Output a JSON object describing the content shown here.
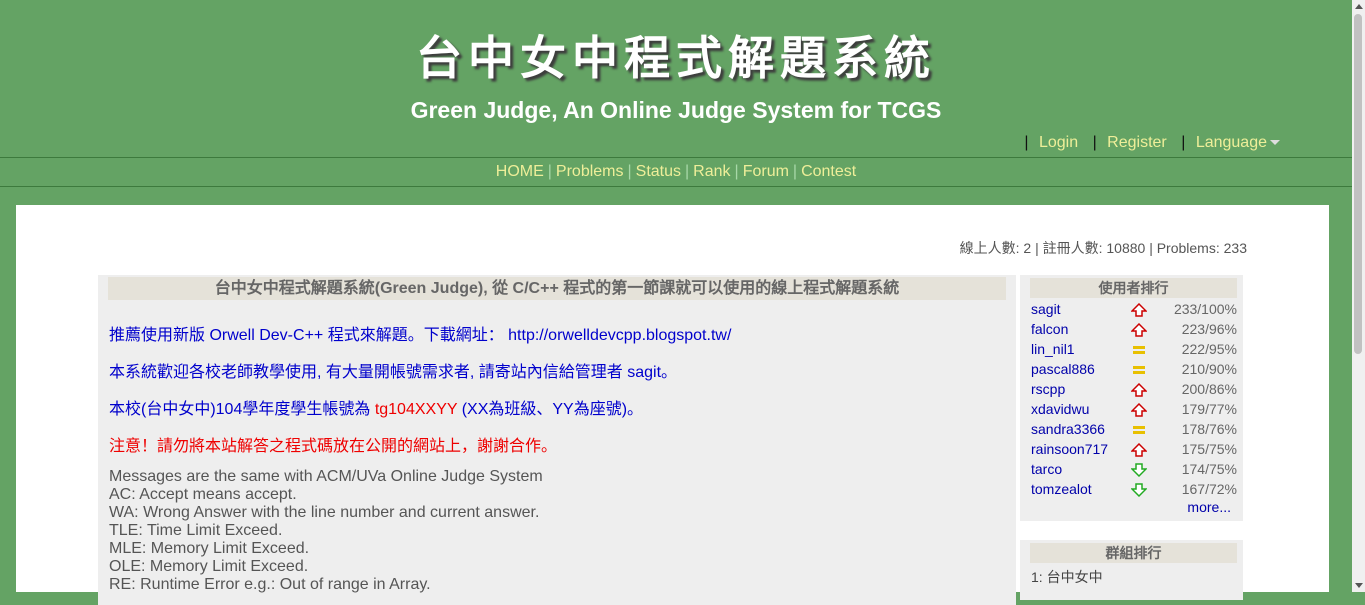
{
  "header": {
    "logo_text": "台中女中程式解題系統",
    "subtitle": "Green Judge, An Online Judge System for TCGS",
    "login": "Login",
    "register": "Register",
    "language": "Language"
  },
  "nav": {
    "home": "HOME",
    "problems": "Problems",
    "status": "Status",
    "rank": "Rank",
    "forum": "Forum",
    "contest": "Contest"
  },
  "stats": "線上人數: 2 | 註冊人數: 10880 | Problems: 233",
  "main": {
    "title": "台中女中程式解題系統(Green Judge), 從 C/C++ 程式的第一節課就可以使用的線上程式解題系統",
    "msg1_text": "推薦使用新版 Orwell Dev-C++ 程式來解題。下載網址：",
    "msg1_link": "http://orwelldevcpp.blogspot.tw/",
    "msg2": "本系統歡迎各校老師教學使用, 有大量開帳號需求者, 請寄站內信給管理者 sagit。",
    "msg3_a": "本校(台中女中)104學年度學生帳號為 ",
    "msg3_b": "tg104XXYY",
    "msg3_c": " (XX為班級、YY為座號)。",
    "msg4": "注意！請勿將本站解答之程式碼放在公開的網站上，謝謝合作。",
    "judge_lines": [
      "Messages are the same with ACM/UVa Online Judge System",
      "AC: Accept means accept.",
      "WA: Wrong Answer with the line number and current answer.",
      "TLE: Time Limit Exceed.",
      "MLE: Memory Limit Exceed.",
      "OLE: Memory Limit Exceed.",
      "RE: Runtime Error e.g.: Out of range in Array."
    ]
  },
  "user_rank": {
    "title": "使用者排行",
    "rows": [
      {
        "name": "sagit",
        "trend": "up",
        "score": "233/100%"
      },
      {
        "name": "falcon",
        "trend": "up",
        "score": "223/96%"
      },
      {
        "name": "lin_nil1",
        "trend": "same",
        "score": "222/95%"
      },
      {
        "name": "pascal886",
        "trend": "same",
        "score": "210/90%"
      },
      {
        "name": "rscpp",
        "trend": "up",
        "score": "200/86%"
      },
      {
        "name": "xdavidwu",
        "trend": "up",
        "score": "179/77%"
      },
      {
        "name": "sandra3366",
        "trend": "same",
        "score": "178/76%"
      },
      {
        "name": "rainsoon717",
        "trend": "up",
        "score": "175/75%"
      },
      {
        "name": "tarco",
        "trend": "down",
        "score": "174/75%"
      },
      {
        "name": "tomzealot",
        "trend": "down",
        "score": "167/72%"
      }
    ],
    "more": "more..."
  },
  "group_rank": {
    "title": "群組排行",
    "first": "1: 台中女中"
  },
  "colors": {
    "header_bg": "#64a364",
    "link_yellow": "#eeee99",
    "trend_up": "#cc0000",
    "trend_same": "#e8c000",
    "trend_down": "#22aa22"
  }
}
